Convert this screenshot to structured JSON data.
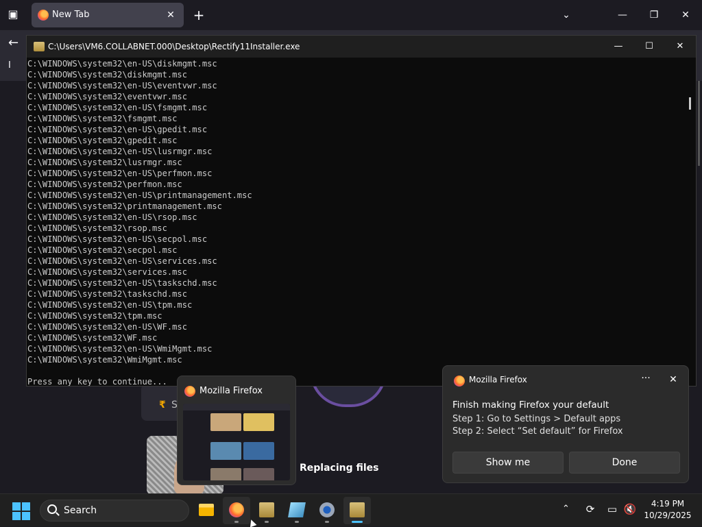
{
  "browser": {
    "tab_title": "New Tab",
    "tab_close": "✕",
    "new_tab": "+",
    "tab_list": "⌄",
    "minimize": "—",
    "maximize": "❐",
    "close": "✕",
    "back": "←",
    "import_label": "I"
  },
  "console": {
    "title": "C:\\Users\\VM6.COLLABNET.000\\Desktop\\Rectify11Installer.exe",
    "minimize": "—",
    "maximize": "☐",
    "close": "✕",
    "lines": [
      "C:\\WINDOWS\\system32\\en-US\\diskmgmt.msc",
      "C:\\WINDOWS\\system32\\diskmgmt.msc",
      "C:\\WINDOWS\\system32\\en-US\\eventvwr.msc",
      "C:\\WINDOWS\\system32\\eventvwr.msc",
      "C:\\WINDOWS\\system32\\en-US\\fsmgmt.msc",
      "C:\\WINDOWS\\system32\\fsmgmt.msc",
      "C:\\WINDOWS\\system32\\en-US\\gpedit.msc",
      "C:\\WINDOWS\\system32\\gpedit.msc",
      "C:\\WINDOWS\\system32\\en-US\\lusrmgr.msc",
      "C:\\WINDOWS\\system32\\lusrmgr.msc",
      "C:\\WINDOWS\\system32\\en-US\\perfmon.msc",
      "C:\\WINDOWS\\system32\\perfmon.msc",
      "C:\\WINDOWS\\system32\\en-US\\printmanagement.msc",
      "C:\\WINDOWS\\system32\\printmanagement.msc",
      "C:\\WINDOWS\\system32\\en-US\\rsop.msc",
      "C:\\WINDOWS\\system32\\rsop.msc",
      "C:\\WINDOWS\\system32\\en-US\\secpol.msc",
      "C:\\WINDOWS\\system32\\secpol.msc",
      "C:\\WINDOWS\\system32\\en-US\\services.msc",
      "C:\\WINDOWS\\system32\\services.msc",
      "C:\\WINDOWS\\system32\\en-US\\taskschd.msc",
      "C:\\WINDOWS\\system32\\taskschd.msc",
      "C:\\WINDOWS\\system32\\en-US\\tpm.msc",
      "C:\\WINDOWS\\system32\\tpm.msc",
      "C:\\WINDOWS\\system32\\en-US\\WF.msc",
      "C:\\WINDOWS\\system32\\WF.msc",
      "C:\\WINDOWS\\system32\\en-US\\WmiMgmt.msc",
      "C:\\WINDOWS\\system32\\WmiMgmt.msc",
      "",
      "Press any key to continue..."
    ]
  },
  "preview": {
    "app_name": "Mozilla Firefox"
  },
  "toast": {
    "app_name": "Mozilla Firefox",
    "more": "···",
    "close": "✕",
    "heading": "Finish making Firefox your default",
    "step1": "Step 1: Go to Settings > Default apps",
    "step2": "Step 2: Select “Set default” for Firefox",
    "show_me": "Show me",
    "done": "Done"
  },
  "background_text": {
    "replacing": "Replacing files",
    "coin": "₹",
    "s": "S"
  },
  "taskbar": {
    "search_label": "Search",
    "chevron": "⌃",
    "time": "4:19 PM",
    "date": "10/29/2025",
    "accent_color": "#4cc2ff"
  }
}
